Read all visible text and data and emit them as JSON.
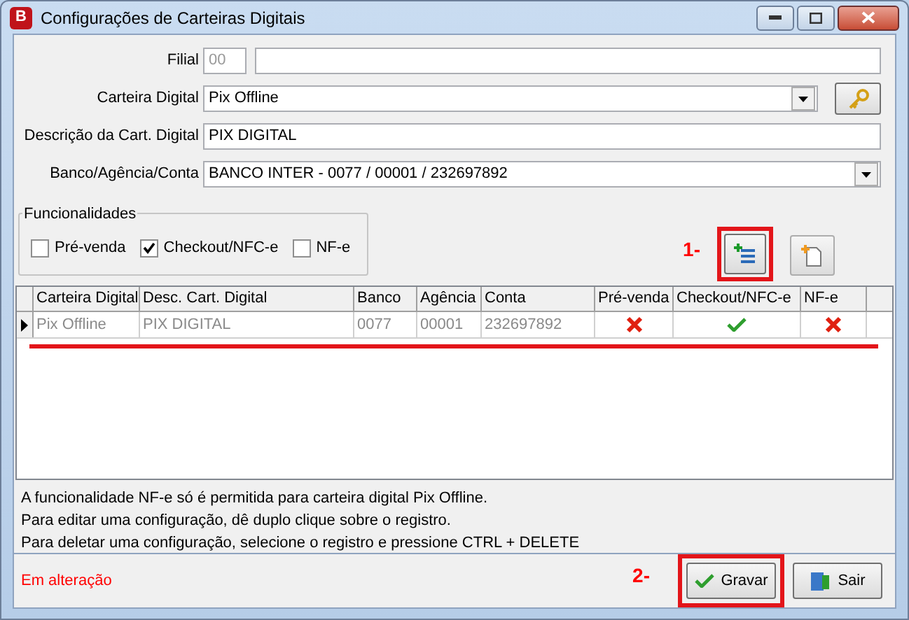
{
  "window": {
    "title": "Configurações de Carteiras Digitais",
    "app_badge": "B"
  },
  "fields": [
    {
      "kind": "pair",
      "label": "Filial",
      "code": "00"
    },
    {
      "kind": "select",
      "label": "Carteira Digital",
      "value": "Pix Offline",
      "key_button": true
    },
    {
      "kind": "input",
      "label": "Descrição da Cart. Digital",
      "value": "PIX DIGITAL"
    },
    {
      "kind": "select",
      "label": "Banco/Agência/Conta",
      "value": "BANCO INTER - 0077 / 00001 / 232697892",
      "key_button": false
    }
  ],
  "funcionalidades": {
    "title": "Funcionalidades",
    "options": [
      {
        "label": "Pré-venda",
        "checked": false
      },
      {
        "label": "Checkout/NFC-e",
        "checked": true
      },
      {
        "label": "NF-e",
        "checked": false
      }
    ]
  },
  "annotations": [
    {
      "label": "1-"
    },
    {
      "label": "2-"
    }
  ],
  "grid": {
    "columns": [
      "Carteira Digital",
      "Desc. Cart. Digital",
      "Banco",
      "Agência",
      "Conta",
      "Pré-venda",
      "Checkout/NFC-e",
      "NF-e"
    ],
    "rows": [
      {
        "current": true,
        "cells": [
          "Pix Offline",
          "PIX DIGITAL",
          "0077",
          "00001",
          "232697892"
        ],
        "flags": [
          false,
          true,
          false
        ]
      }
    ]
  },
  "notes": [
    "A funcionalidade NF-e só é permitida para carteira digital Pix Offline.",
    "Para editar uma configuração, dê duplo clique sobre o registro.",
    "Para deletar uma configuração, selecione o registro e pressione CTRL + DELETE"
  ],
  "status": "Em alteração",
  "buttons": [
    {
      "kind": "save",
      "label": "Gravar",
      "highlighted": true
    },
    {
      "kind": "exit",
      "label": "Sair",
      "highlighted": false
    }
  ]
}
